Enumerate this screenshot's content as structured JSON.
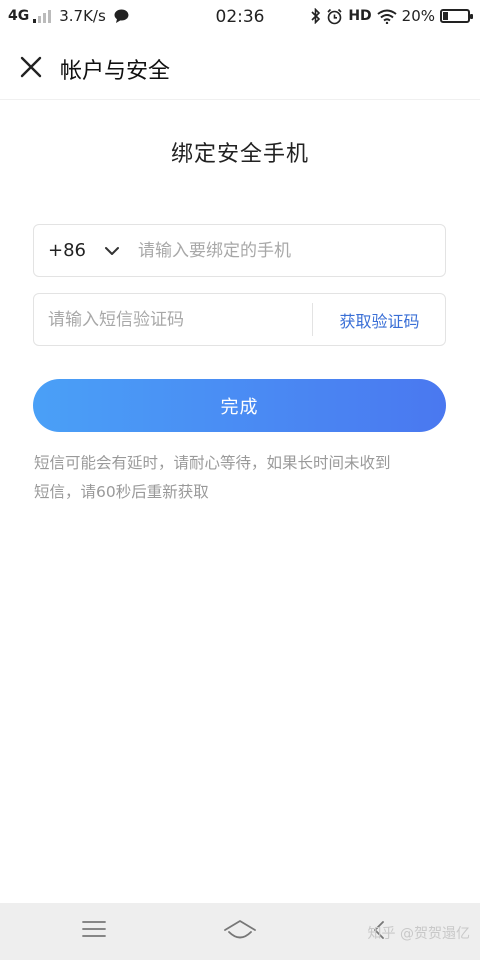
{
  "status_bar": {
    "network": "4G",
    "speed": "3.7K/s",
    "time": "02:36",
    "hd": "HD",
    "battery_percent": "20%",
    "battery_level": 0.2
  },
  "nav": {
    "title": "帐户与安全"
  },
  "page": {
    "heading": "绑定安全手机"
  },
  "phone": {
    "country_code": "+86",
    "placeholder": "请输入要绑定的手机"
  },
  "code": {
    "placeholder": "请输入短信验证码",
    "get_code_label": "获取验证码"
  },
  "submit_label": "完成",
  "hint_line1": "短信可能会有延时，请耐心等待，如果长时间未收到",
  "hint_line2": "短信，请60秒后重新获取",
  "watermark": "知乎 @贺贺遢亿",
  "colors": {
    "accent": "#3a6fd6",
    "button_start": "#4aa0f7",
    "button_end": "#4a78f0"
  }
}
